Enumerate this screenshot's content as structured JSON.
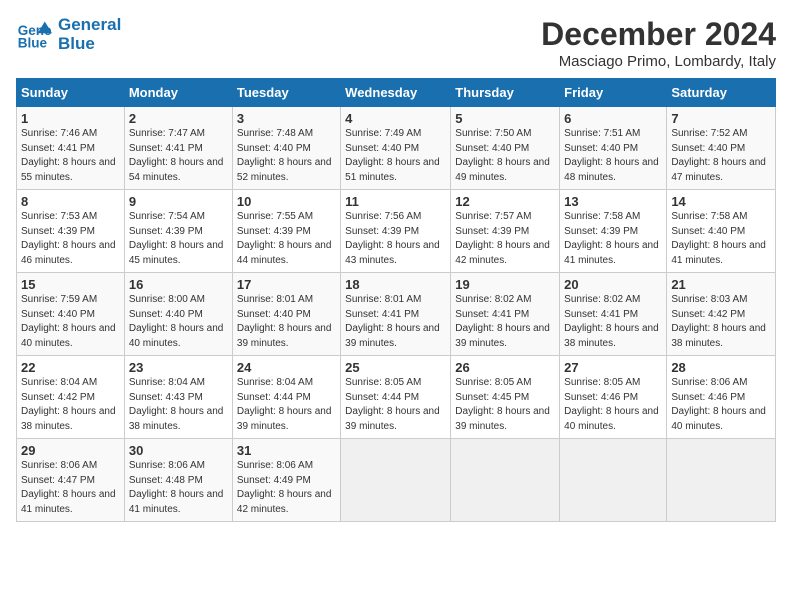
{
  "logo": {
    "line1": "General",
    "line2": "Blue"
  },
  "title": "December 2024",
  "location": "Masciago Primo, Lombardy, Italy",
  "days_of_week": [
    "Sunday",
    "Monday",
    "Tuesday",
    "Wednesday",
    "Thursday",
    "Friday",
    "Saturday"
  ],
  "weeks": [
    [
      {
        "day": "1",
        "sunrise": "7:46 AM",
        "sunset": "4:41 PM",
        "daylight": "8 hours and 55 minutes."
      },
      {
        "day": "2",
        "sunrise": "7:47 AM",
        "sunset": "4:41 PM",
        "daylight": "8 hours and 54 minutes."
      },
      {
        "day": "3",
        "sunrise": "7:48 AM",
        "sunset": "4:40 PM",
        "daylight": "8 hours and 52 minutes."
      },
      {
        "day": "4",
        "sunrise": "7:49 AM",
        "sunset": "4:40 PM",
        "daylight": "8 hours and 51 minutes."
      },
      {
        "day": "5",
        "sunrise": "7:50 AM",
        "sunset": "4:40 PM",
        "daylight": "8 hours and 49 minutes."
      },
      {
        "day": "6",
        "sunrise": "7:51 AM",
        "sunset": "4:40 PM",
        "daylight": "8 hours and 48 minutes."
      },
      {
        "day": "7",
        "sunrise": "7:52 AM",
        "sunset": "4:40 PM",
        "daylight": "8 hours and 47 minutes."
      }
    ],
    [
      {
        "day": "8",
        "sunrise": "7:53 AM",
        "sunset": "4:39 PM",
        "daylight": "8 hours and 46 minutes."
      },
      {
        "day": "9",
        "sunrise": "7:54 AM",
        "sunset": "4:39 PM",
        "daylight": "8 hours and 45 minutes."
      },
      {
        "day": "10",
        "sunrise": "7:55 AM",
        "sunset": "4:39 PM",
        "daylight": "8 hours and 44 minutes."
      },
      {
        "day": "11",
        "sunrise": "7:56 AM",
        "sunset": "4:39 PM",
        "daylight": "8 hours and 43 minutes."
      },
      {
        "day": "12",
        "sunrise": "7:57 AM",
        "sunset": "4:39 PM",
        "daylight": "8 hours and 42 minutes."
      },
      {
        "day": "13",
        "sunrise": "7:58 AM",
        "sunset": "4:39 PM",
        "daylight": "8 hours and 41 minutes."
      },
      {
        "day": "14",
        "sunrise": "7:58 AM",
        "sunset": "4:40 PM",
        "daylight": "8 hours and 41 minutes."
      }
    ],
    [
      {
        "day": "15",
        "sunrise": "7:59 AM",
        "sunset": "4:40 PM",
        "daylight": "8 hours and 40 minutes."
      },
      {
        "day": "16",
        "sunrise": "8:00 AM",
        "sunset": "4:40 PM",
        "daylight": "8 hours and 40 minutes."
      },
      {
        "day": "17",
        "sunrise": "8:01 AM",
        "sunset": "4:40 PM",
        "daylight": "8 hours and 39 minutes."
      },
      {
        "day": "18",
        "sunrise": "8:01 AM",
        "sunset": "4:41 PM",
        "daylight": "8 hours and 39 minutes."
      },
      {
        "day": "19",
        "sunrise": "8:02 AM",
        "sunset": "4:41 PM",
        "daylight": "8 hours and 39 minutes."
      },
      {
        "day": "20",
        "sunrise": "8:02 AM",
        "sunset": "4:41 PM",
        "daylight": "8 hours and 38 minutes."
      },
      {
        "day": "21",
        "sunrise": "8:03 AM",
        "sunset": "4:42 PM",
        "daylight": "8 hours and 38 minutes."
      }
    ],
    [
      {
        "day": "22",
        "sunrise": "8:04 AM",
        "sunset": "4:42 PM",
        "daylight": "8 hours and 38 minutes."
      },
      {
        "day": "23",
        "sunrise": "8:04 AM",
        "sunset": "4:43 PM",
        "daylight": "8 hours and 38 minutes."
      },
      {
        "day": "24",
        "sunrise": "8:04 AM",
        "sunset": "4:44 PM",
        "daylight": "8 hours and 39 minutes."
      },
      {
        "day": "25",
        "sunrise": "8:05 AM",
        "sunset": "4:44 PM",
        "daylight": "8 hours and 39 minutes."
      },
      {
        "day": "26",
        "sunrise": "8:05 AM",
        "sunset": "4:45 PM",
        "daylight": "8 hours and 39 minutes."
      },
      {
        "day": "27",
        "sunrise": "8:05 AM",
        "sunset": "4:46 PM",
        "daylight": "8 hours and 40 minutes."
      },
      {
        "day": "28",
        "sunrise": "8:06 AM",
        "sunset": "4:46 PM",
        "daylight": "8 hours and 40 minutes."
      }
    ],
    [
      {
        "day": "29",
        "sunrise": "8:06 AM",
        "sunset": "4:47 PM",
        "daylight": "8 hours and 41 minutes."
      },
      {
        "day": "30",
        "sunrise": "8:06 AM",
        "sunset": "4:48 PM",
        "daylight": "8 hours and 41 minutes."
      },
      {
        "day": "31",
        "sunrise": "8:06 AM",
        "sunset": "4:49 PM",
        "daylight": "8 hours and 42 minutes."
      },
      null,
      null,
      null,
      null
    ]
  ]
}
